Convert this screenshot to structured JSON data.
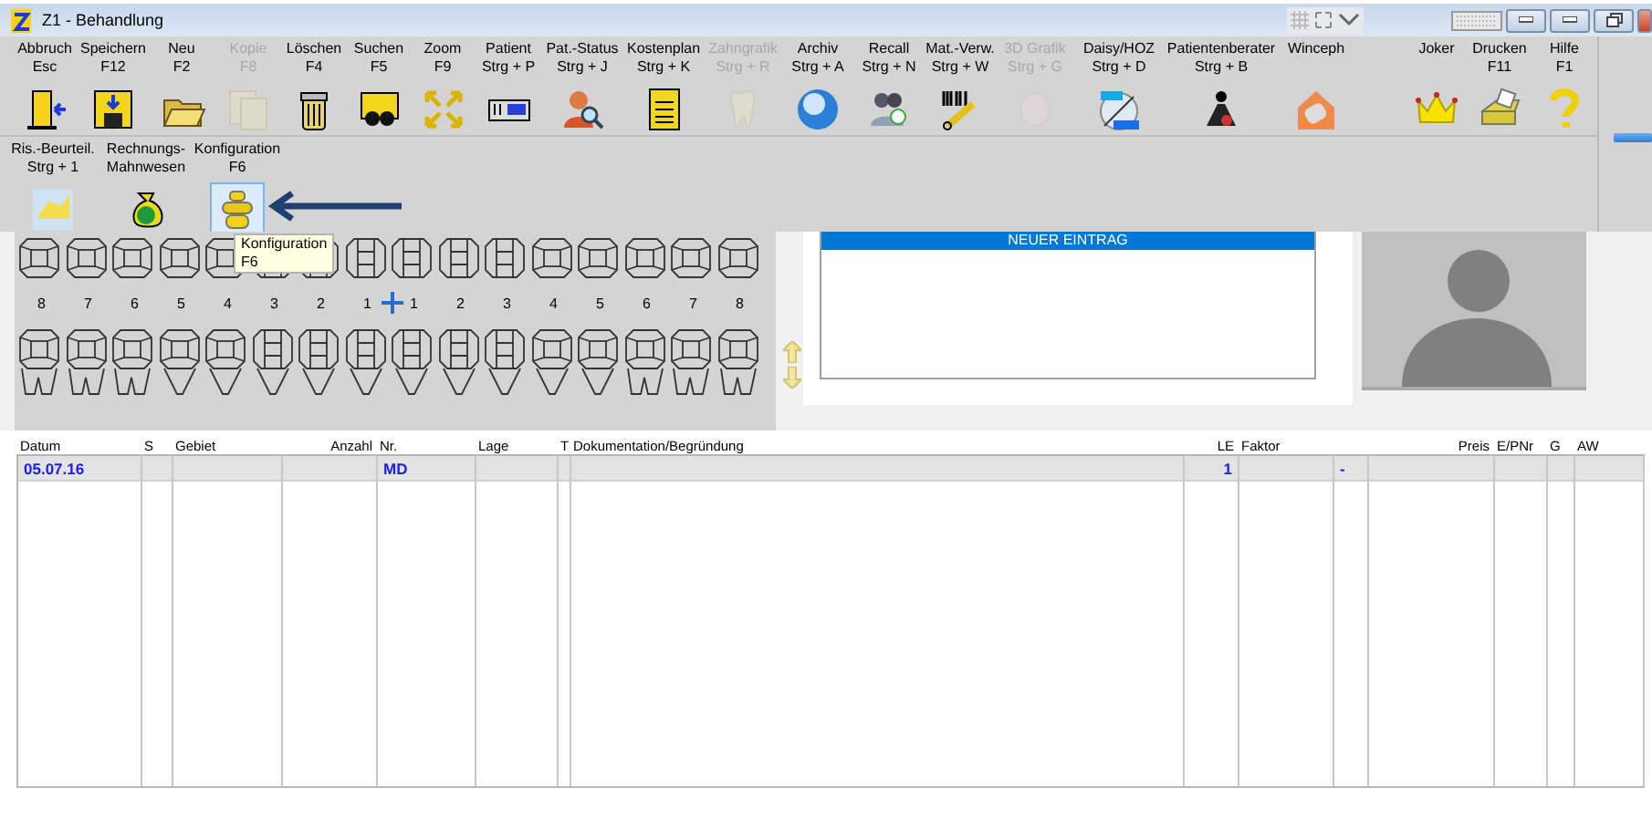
{
  "window": {
    "title": "Z1 - Behandlung"
  },
  "toolbar": [
    {
      "label": "Abbruch",
      "shortcut": "Esc",
      "disabled": false
    },
    {
      "label": "Speichern",
      "shortcut": "F12",
      "disabled": false
    },
    {
      "label": "Neu",
      "shortcut": "F2",
      "disabled": false
    },
    {
      "label": "Kopie",
      "shortcut": "F8",
      "disabled": true
    },
    {
      "label": "Löschen",
      "shortcut": "F4",
      "disabled": false
    },
    {
      "label": "Suchen",
      "shortcut": "F5",
      "disabled": false
    },
    {
      "label": "Zoom",
      "shortcut": "F9",
      "disabled": false
    },
    {
      "label": "Patient",
      "shortcut": "Strg + P",
      "disabled": false
    },
    {
      "label": "Pat.-Status",
      "shortcut": "Strg + J",
      "disabled": false
    },
    {
      "label": "Kostenplan",
      "shortcut": "Strg + K",
      "disabled": false
    },
    {
      "label": "Zahngrafik",
      "shortcut": "Strg + R",
      "disabled": true
    },
    {
      "label": "Archiv",
      "shortcut": "Strg + A",
      "disabled": false
    },
    {
      "label": "Recall",
      "shortcut": "Strg + N",
      "disabled": false
    },
    {
      "label": "Mat.-Verw.",
      "shortcut": "Strg + W",
      "disabled": false
    },
    {
      "label": "3D Grafik",
      "shortcut": "Strg + G",
      "disabled": true
    },
    {
      "label": "Daisy/HOZ",
      "shortcut": "Strg + D",
      "disabled": false
    },
    {
      "label": "Patientenberater",
      "shortcut": "Strg + B",
      "disabled": false
    },
    {
      "label": "Winceph",
      "disabled": false
    },
    {
      "label": "Joker",
      "disabled": false
    },
    {
      "label": "Drucken",
      "shortcut": "F11",
      "disabled": false
    },
    {
      "label": "Hilfe",
      "shortcut": "F1",
      "disabled": false
    }
  ],
  "toolbar_secondary": [
    {
      "label": "Ris.-Beurteil.",
      "shortcut": "Strg + 1",
      "selected": false
    },
    {
      "label": "Rechnungs-",
      "shortcut": "Mahnwesen",
      "selected": false
    },
    {
      "label": "Konfiguration",
      "shortcut": "F6",
      "selected": true
    }
  ],
  "tooltip": {
    "title": "Konfiguration",
    "shortcut": "F6"
  },
  "teeth": [
    {
      "number": "8",
      "kind": "molar"
    },
    {
      "number": "7",
      "kind": "molar"
    },
    {
      "number": "6",
      "kind": "molar"
    },
    {
      "number": "5",
      "kind": "premolar"
    },
    {
      "number": "4",
      "kind": "premolar"
    },
    {
      "number": "3",
      "kind": "front"
    },
    {
      "number": "2",
      "kind": "front"
    },
    {
      "number": "1",
      "kind": "front"
    },
    {
      "number": "1",
      "kind": "front"
    },
    {
      "number": "2",
      "kind": "front"
    },
    {
      "number": "3",
      "kind": "front"
    },
    {
      "number": "4",
      "kind": "premolar"
    },
    {
      "number": "5",
      "kind": "premolar"
    },
    {
      "number": "6",
      "kind": "molar"
    },
    {
      "number": "7",
      "kind": "molar"
    },
    {
      "number": "8",
      "kind": "molar"
    }
  ],
  "entries": [
    {
      "text": "NEUER EINTRAG",
      "selected": true
    }
  ],
  "table": {
    "columns": [
      {
        "label": "Datum"
      },
      {
        "label": "S"
      },
      {
        "label": "Gebiet"
      },
      {
        "label": "Anzahl"
      },
      {
        "label": "Nr."
      },
      {
        "label": "Lage"
      },
      {
        "label": "T"
      },
      {
        "label": "Dokumentation/Begründung"
      },
      {
        "label": "LE"
      },
      {
        "label": "Faktor"
      },
      {},
      {
        "label": "Preis"
      },
      {
        "label": "E/PNr"
      },
      {
        "label": "G"
      },
      {
        "label": "AW"
      }
    ],
    "rows": [
      {
        "selected": true,
        "cells": [
          {
            "text": "05.07.16"
          },
          {},
          {},
          {},
          {
            "text": "MD"
          },
          {},
          {},
          {},
          {
            "text": "1"
          },
          {},
          {
            "text": "-"
          },
          {},
          {},
          {},
          {}
        ]
      }
    ]
  }
}
